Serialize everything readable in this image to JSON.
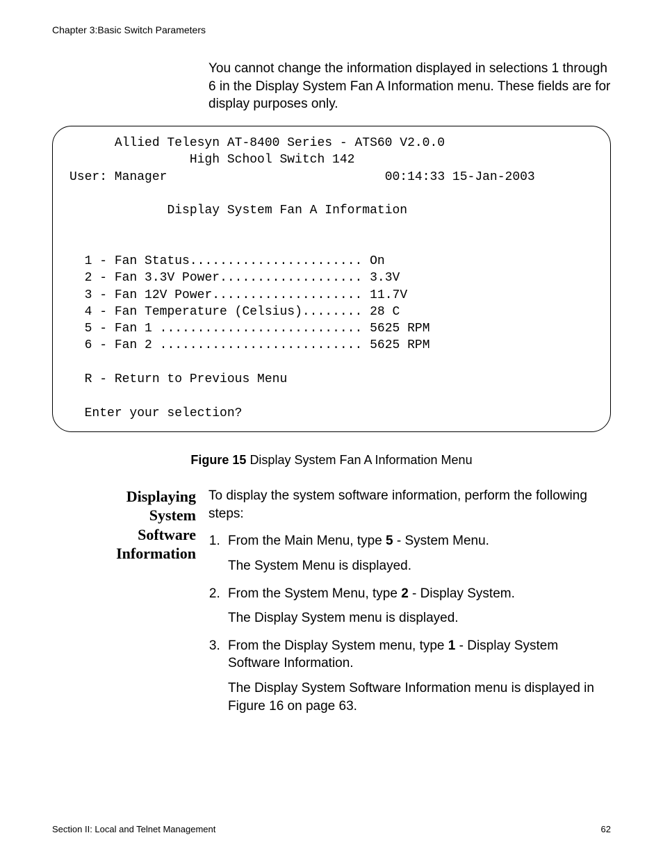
{
  "header": {
    "chapter_line": "Chapter 3:Basic Switch Parameters"
  },
  "intro": {
    "text": "You cannot change the information displayed in selections 1 through 6 in the Display System Fan A Information menu. These fields are for display purposes only."
  },
  "terminal": {
    "title_line1": "Allied Telesyn AT-8400 Series - ATS60 V2.0.0",
    "title_line2": "High School Switch 142",
    "user_label": "User: Manager",
    "timestamp": "00:14:33 15-Jan-2003",
    "subtitle": "Display System Fan A Information",
    "rows": [
      {
        "n": "1",
        "label": "Fan Status",
        "dots": ".......................",
        "value": "On"
      },
      {
        "n": "2",
        "label": "Fan 3.3V Power",
        "dots": "...................",
        "value": "3.3V"
      },
      {
        "n": "3",
        "label": "Fan 12V Power",
        "dots": "....................",
        "value": "11.7V"
      },
      {
        "n": "4",
        "label": "Fan Temperature (Celsius)",
        "dots": "........",
        "value": "28 C"
      },
      {
        "n": "5",
        "label": "Fan 1 ",
        "dots": "...........................",
        "value": "5625 RPM"
      },
      {
        "n": "6",
        "label": "Fan 2 ",
        "dots": "...........................",
        "value": "5625 RPM"
      }
    ],
    "return_line": "R - Return to Previous Menu",
    "prompt": "Enter your selection?"
  },
  "figure": {
    "label": "Figure 15",
    "caption": "Display System Fan A Information Menu"
  },
  "section": {
    "heading_l1": "Displaying",
    "heading_l2": "System",
    "heading_l3": "Software",
    "heading_l4": "Information",
    "lead": "To display the system software information, perform the following steps:",
    "steps": {
      "s1a": "From the Main Menu, type ",
      "s1bold": "5",
      "s1b": " - System Menu.",
      "s1r": "The System Menu is displayed.",
      "s2a": "From the System Menu, type ",
      "s2bold": "2",
      "s2b": " - Display System.",
      "s2r": "The Display System menu is displayed.",
      "s3a": "From the Display System menu, type ",
      "s3bold": "1",
      "s3b": " - Display System Software Information.",
      "s3r": "The Display System Software Information menu is displayed in Figure 16 on page 63."
    }
  },
  "footer": {
    "left": "Section II: Local and Telnet Management",
    "right": "62"
  }
}
